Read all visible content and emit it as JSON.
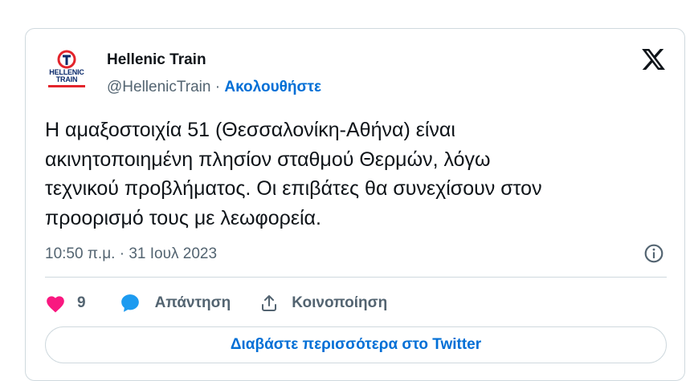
{
  "account": {
    "avatar_brand_line1": "HELLENIC",
    "avatar_brand_line2": "TRAIN",
    "display_name": "Hellenic Train",
    "handle": "@HellenicTrain",
    "separator": "·",
    "follow_label": "Ακολουθήστε"
  },
  "tweet": {
    "text": "Η αμαξοστοιχία 51 (Θεσσαλονίκη-Αθήνα) είναι\nακινητοποιημένη πλησίον σταθμού Θερμών, λόγω\nτεχνικού προβλήματος. Οι επιβάτες θα συνεχίσουν στον\nπροορισμό τους με λεωφορεία.",
    "timestamp": "10:50 π.μ. · 31 Ιουλ 2023"
  },
  "actions": {
    "like_count": "9",
    "reply_label": "Απάντηση",
    "share_label": "Κοινοποίηση"
  },
  "read_more_label": "Διαβάστε περισσότερα στο Twitter",
  "colors": {
    "link": "#006fd6",
    "heart": "#f91880",
    "reply_bubble": "#1d9bf0",
    "secondary_text": "#536471",
    "border": "#cfd9de",
    "brand_navy": "#0a2a6b",
    "brand_red": "#e3242b"
  },
  "icons": {
    "x_logo": "x-logo-icon",
    "info": "info-icon",
    "like": "heart-icon",
    "reply": "speech-bubble-icon",
    "share": "upload-share-icon"
  }
}
